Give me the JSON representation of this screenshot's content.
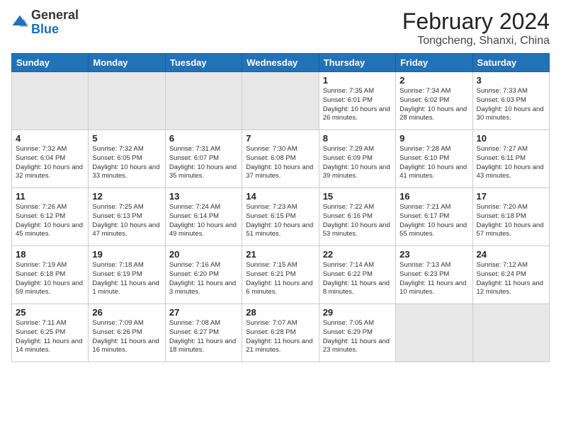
{
  "logo": {
    "general": "General",
    "blue": "Blue"
  },
  "title": "February 2024",
  "location": "Tongcheng, Shanxi, China",
  "days_of_week": [
    "Sunday",
    "Monday",
    "Tuesday",
    "Wednesday",
    "Thursday",
    "Friday",
    "Saturday"
  ],
  "weeks": [
    [
      {
        "day": null,
        "text": null,
        "shade": true
      },
      {
        "day": null,
        "text": null,
        "shade": true
      },
      {
        "day": null,
        "text": null,
        "shade": true
      },
      {
        "day": null,
        "text": null,
        "shade": true
      },
      {
        "day": "1",
        "text": "Sunrise: 7:35 AM\nSunset: 6:01 PM\nDaylight: 10 hours and 26 minutes."
      },
      {
        "day": "2",
        "text": "Sunrise: 7:34 AM\nSunset: 6:02 PM\nDaylight: 10 hours and 28 minutes."
      },
      {
        "day": "3",
        "text": "Sunrise: 7:33 AM\nSunset: 6:03 PM\nDaylight: 10 hours and 30 minutes."
      }
    ],
    [
      {
        "day": "4",
        "text": "Sunrise: 7:32 AM\nSunset: 6:04 PM\nDaylight: 10 hours and 32 minutes."
      },
      {
        "day": "5",
        "text": "Sunrise: 7:32 AM\nSunset: 6:05 PM\nDaylight: 10 hours and 33 minutes."
      },
      {
        "day": "6",
        "text": "Sunrise: 7:31 AM\nSunset: 6:07 PM\nDaylight: 10 hours and 35 minutes."
      },
      {
        "day": "7",
        "text": "Sunrise: 7:30 AM\nSunset: 6:08 PM\nDaylight: 10 hours and 37 minutes."
      },
      {
        "day": "8",
        "text": "Sunrise: 7:29 AM\nSunset: 6:09 PM\nDaylight: 10 hours and 39 minutes."
      },
      {
        "day": "9",
        "text": "Sunrise: 7:28 AM\nSunset: 6:10 PM\nDaylight: 10 hours and 41 minutes."
      },
      {
        "day": "10",
        "text": "Sunrise: 7:27 AM\nSunset: 6:11 PM\nDaylight: 10 hours and 43 minutes."
      }
    ],
    [
      {
        "day": "11",
        "text": "Sunrise: 7:26 AM\nSunset: 6:12 PM\nDaylight: 10 hours and 45 minutes."
      },
      {
        "day": "12",
        "text": "Sunrise: 7:25 AM\nSunset: 6:13 PM\nDaylight: 10 hours and 47 minutes."
      },
      {
        "day": "13",
        "text": "Sunrise: 7:24 AM\nSunset: 6:14 PM\nDaylight: 10 hours and 49 minutes."
      },
      {
        "day": "14",
        "text": "Sunrise: 7:23 AM\nSunset: 6:15 PM\nDaylight: 10 hours and 51 minutes."
      },
      {
        "day": "15",
        "text": "Sunrise: 7:22 AM\nSunset: 6:16 PM\nDaylight: 10 hours and 53 minutes."
      },
      {
        "day": "16",
        "text": "Sunrise: 7:21 AM\nSunset: 6:17 PM\nDaylight: 10 hours and 55 minutes."
      },
      {
        "day": "17",
        "text": "Sunrise: 7:20 AM\nSunset: 6:18 PM\nDaylight: 10 hours and 57 minutes."
      }
    ],
    [
      {
        "day": "18",
        "text": "Sunrise: 7:19 AM\nSunset: 6:18 PM\nDaylight: 10 hours and 59 minutes."
      },
      {
        "day": "19",
        "text": "Sunrise: 7:18 AM\nSunset: 6:19 PM\nDaylight: 11 hours and 1 minute."
      },
      {
        "day": "20",
        "text": "Sunrise: 7:16 AM\nSunset: 6:20 PM\nDaylight: 11 hours and 3 minutes."
      },
      {
        "day": "21",
        "text": "Sunrise: 7:15 AM\nSunset: 6:21 PM\nDaylight: 11 hours and 6 minutes."
      },
      {
        "day": "22",
        "text": "Sunrise: 7:14 AM\nSunset: 6:22 PM\nDaylight: 11 hours and 8 minutes."
      },
      {
        "day": "23",
        "text": "Sunrise: 7:13 AM\nSunset: 6:23 PM\nDaylight: 11 hours and 10 minutes."
      },
      {
        "day": "24",
        "text": "Sunrise: 7:12 AM\nSunset: 6:24 PM\nDaylight: 11 hours and 12 minutes."
      }
    ],
    [
      {
        "day": "25",
        "text": "Sunrise: 7:11 AM\nSunset: 6:25 PM\nDaylight: 11 hours and 14 minutes."
      },
      {
        "day": "26",
        "text": "Sunrise: 7:09 AM\nSunset: 6:26 PM\nDaylight: 11 hours and 16 minutes."
      },
      {
        "day": "27",
        "text": "Sunrise: 7:08 AM\nSunset: 6:27 PM\nDaylight: 11 hours and 18 minutes."
      },
      {
        "day": "28",
        "text": "Sunrise: 7:07 AM\nSunset: 6:28 PM\nDaylight: 11 hours and 21 minutes."
      },
      {
        "day": "29",
        "text": "Sunrise: 7:05 AM\nSunset: 6:29 PM\nDaylight: 11 hours and 23 minutes."
      },
      {
        "day": null,
        "text": null,
        "shade": true
      },
      {
        "day": null,
        "text": null,
        "shade": true
      }
    ]
  ]
}
